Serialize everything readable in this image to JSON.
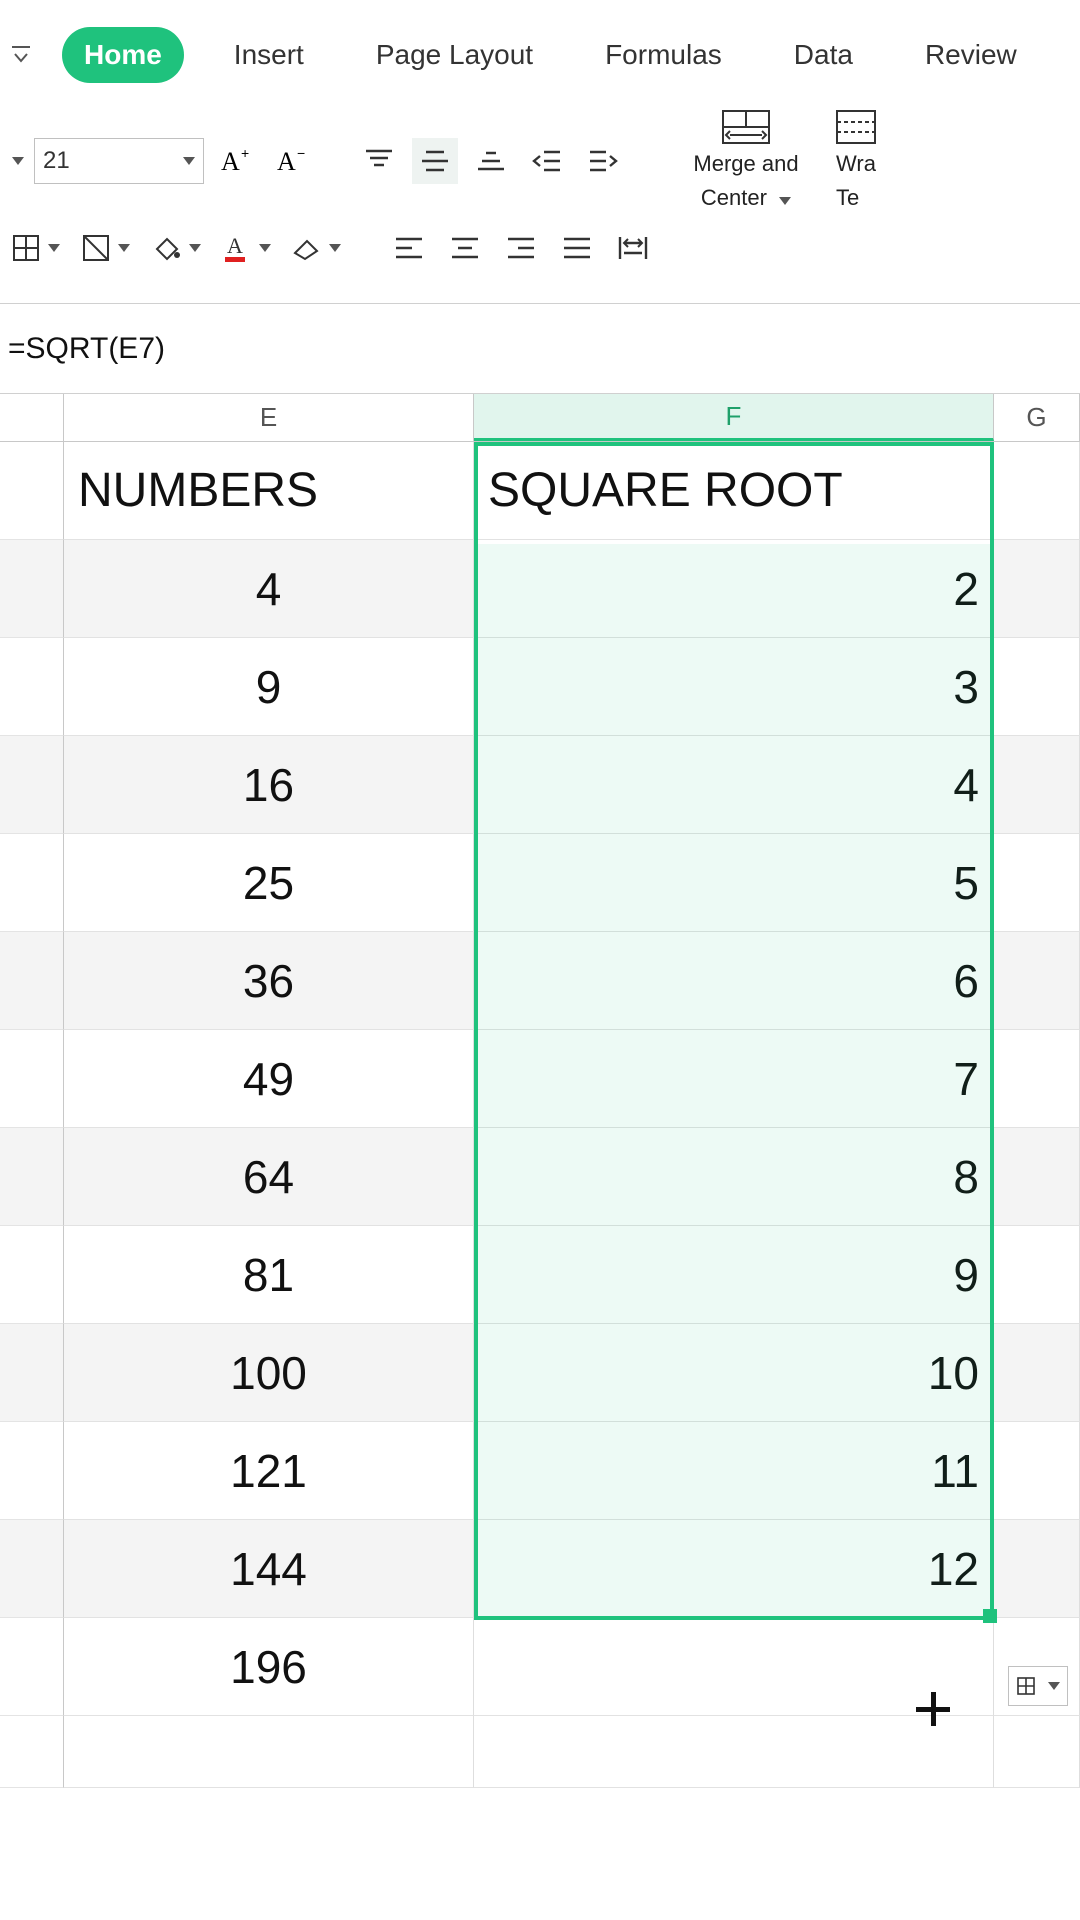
{
  "ribbon": {
    "tabs": [
      "Home",
      "Insert",
      "Page Layout",
      "Formulas",
      "Data",
      "Review"
    ],
    "active_tab": "Home"
  },
  "toolbar": {
    "font_size": "21",
    "merge_line1": "Merge and",
    "merge_line2": "Center",
    "wrap_line1": "Wra",
    "wrap_line2": "Te"
  },
  "formula_bar": "=SQRT(E7)",
  "columns": {
    "E": "E",
    "F": "F",
    "G": "G"
  },
  "headers": {
    "numbers": "NUMBERS",
    "sqroot": "SQUARE ROOT"
  },
  "chart_data": {
    "type": "table",
    "title": "Square roots",
    "columns": [
      "NUMBERS",
      "SQUARE ROOT"
    ],
    "rows": [
      {
        "n": "4",
        "r": "2"
      },
      {
        "n": "9",
        "r": "3"
      },
      {
        "n": "16",
        "r": "4"
      },
      {
        "n": "25",
        "r": "5"
      },
      {
        "n": "36",
        "r": "6"
      },
      {
        "n": "49",
        "r": "7"
      },
      {
        "n": "64",
        "r": "8"
      },
      {
        "n": "81",
        "r": "9"
      },
      {
        "n": "100",
        "r": "10"
      },
      {
        "n": "121",
        "r": "11"
      },
      {
        "n": "144",
        "r": "12"
      },
      {
        "n": "196",
        "r": ""
      }
    ]
  },
  "selection": {
    "range": "F7:F17",
    "active_cell": "F7",
    "selected_column": "F"
  }
}
